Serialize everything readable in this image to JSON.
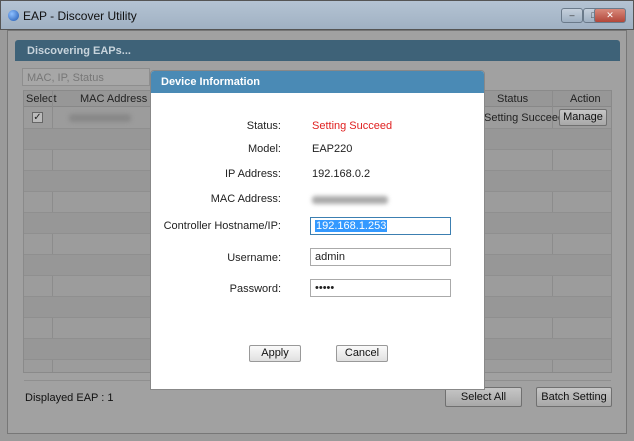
{
  "window": {
    "title": "EAP - Discover Utility",
    "controls": [
      "minimize",
      "maximize",
      "close"
    ]
  },
  "panel": {
    "title": "Discovering EAPs..."
  },
  "filter": {
    "placeholder": "MAC, IP, Status"
  },
  "table": {
    "columns": [
      "Select",
      "MAC Address",
      "Status",
      "Action"
    ],
    "rows": [
      {
        "selected": true,
        "status": "Setting Succeed",
        "action": "Manage"
      }
    ]
  },
  "footer": {
    "displayed": "Displayed EAP : 1",
    "select_all": "Select All",
    "batch_setting": "Batch Setting"
  },
  "dialog": {
    "title": "Device Information",
    "status_label": "Status:",
    "status_value": "Setting Succeed",
    "model_label": "Model:",
    "model_value": "EAP220",
    "ip_label": "IP Address:",
    "ip_value": "192.168.0.2",
    "mac_label": "MAC Address:",
    "controller_label": "Controller Hostname/IP:",
    "controller_value": "192.168.1.253",
    "username_label": "Username:",
    "username_value": "admin",
    "password_label": "Password:",
    "password_value": "•••••",
    "apply": "Apply",
    "cancel": "Cancel"
  },
  "colors": {
    "panel_header": "#3e6278",
    "dialog_header": "#4a8ab5",
    "status_success": "#e02020",
    "selection": "#3399ff"
  }
}
